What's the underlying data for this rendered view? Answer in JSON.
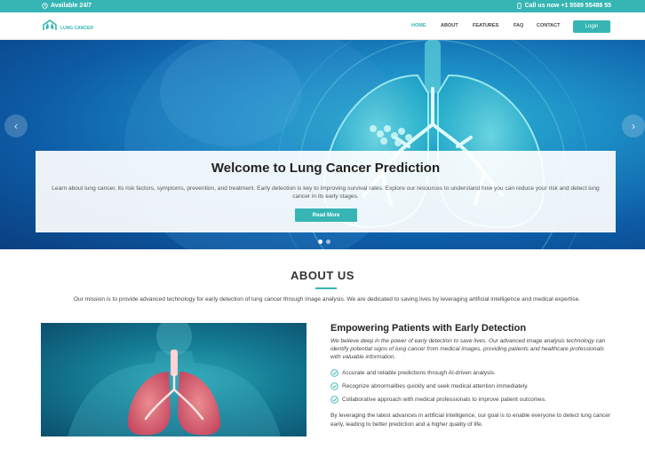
{
  "topbar": {
    "availability": "Available 24/7",
    "phone": "Call us now +1 5589 55488 55"
  },
  "nav": {
    "logo_text": "LUNG CANCER",
    "items": [
      "HOME",
      "ABOUT",
      "FEATURES",
      "FAQ",
      "CONTACT"
    ],
    "active": "HOME",
    "login_label": "Login"
  },
  "hero": {
    "title": "Welcome to Lung Cancer Prediction",
    "description": "Learn about lung cancer, its risk factors, symptoms, prevention, and treatment. Early detection is key to improving survival rates. Explore our resources to understand how you can reduce your risk and detect lung cancer in its early stages.",
    "button_label": "Read More",
    "prev_icon": "chevron-left-icon",
    "next_icon": "chevron-right-icon",
    "slide_count": 2,
    "active_slide": 1
  },
  "about": {
    "title": "ABOUT US",
    "description": "Our mission is to provide advanced technology for early detection of lung cancer through image analysis. We are dedicated to saving lives by leveraging artificial intelligence and medical expertise.",
    "heading": "Empowering Patients with Early Detection",
    "intro": "We believe deep in the power of early detection to save lives. Our advanced image analysis technology can identify potential signs of lung cancer from medical images, providing patients and healthcare professionals with valuable information.",
    "checks": [
      "Accurate and reliable predictions through AI-driven analysis.",
      "Recognize abnormalities quickly and seek medical attention immediately.",
      "Collaborative approach with medical professionals to improve patient outcomes."
    ],
    "outro": "By leveraging the latest advances in artificial intelligence, our goal is to enable everyone to detect lung cancer early, leading to better prediction and a higher quality of life."
  },
  "colors": {
    "accent": "#36b5b4",
    "hero_dark": "#0a3f80"
  }
}
